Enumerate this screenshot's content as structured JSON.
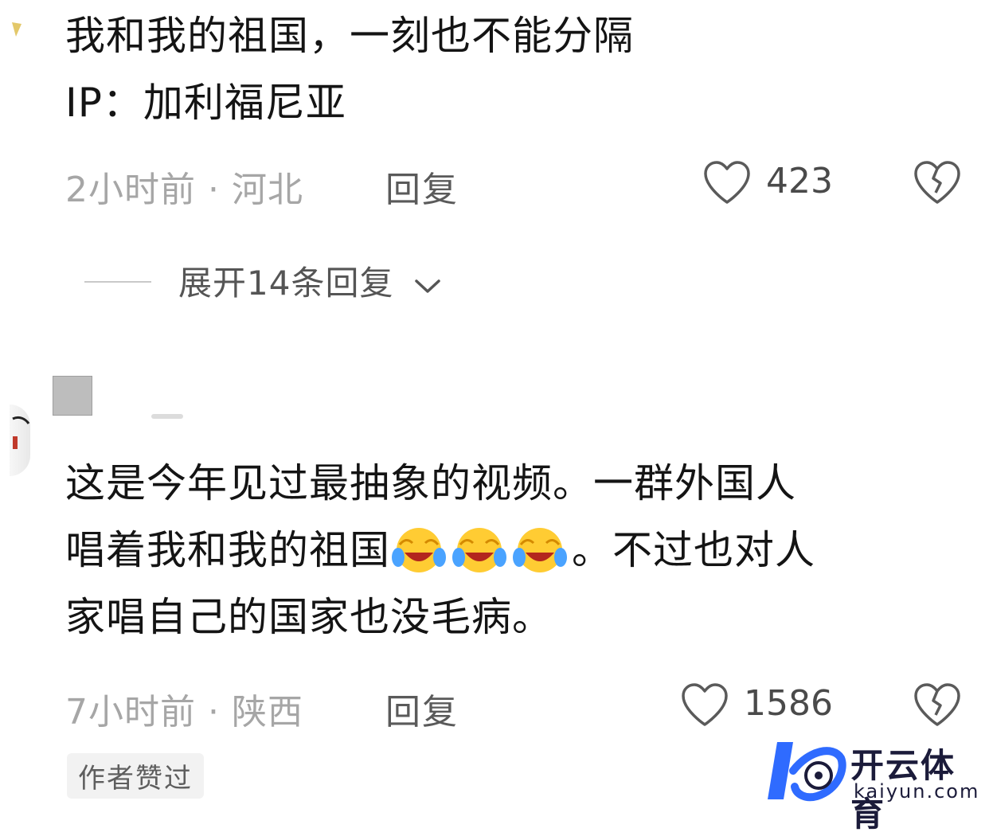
{
  "comments": [
    {
      "text_line1": "我和我的祖国，一刻也不能分隔",
      "text_line2": "IP：加利福尼亚",
      "time": "2小时前",
      "location": "河北",
      "reply_label": "回复",
      "likes": "423",
      "expand_label": "展开14条回复"
    },
    {
      "text_line1": "这是今年见过最抽象的视频。一群外国人",
      "text_line2_start": "唱着我和我的祖国",
      "text_line2_end": "。不过也对人",
      "text_line3": "家唱自己的国家也没毛病。",
      "time": "7小时前",
      "location": "陕西",
      "reply_label": "回复",
      "likes": "1586",
      "author_badge": "作者赞过"
    }
  ],
  "watermark": {
    "brand_cn": "开云体育",
    "brand_url": "kaiyun.com"
  },
  "colors": {
    "meta_text": "#a6a6a6",
    "accent_logo": "#2f6bff"
  },
  "icons": [
    "heart-outline-icon",
    "broken-heart-icon",
    "chevron-down-icon",
    "laughing-crying-emoji"
  ]
}
